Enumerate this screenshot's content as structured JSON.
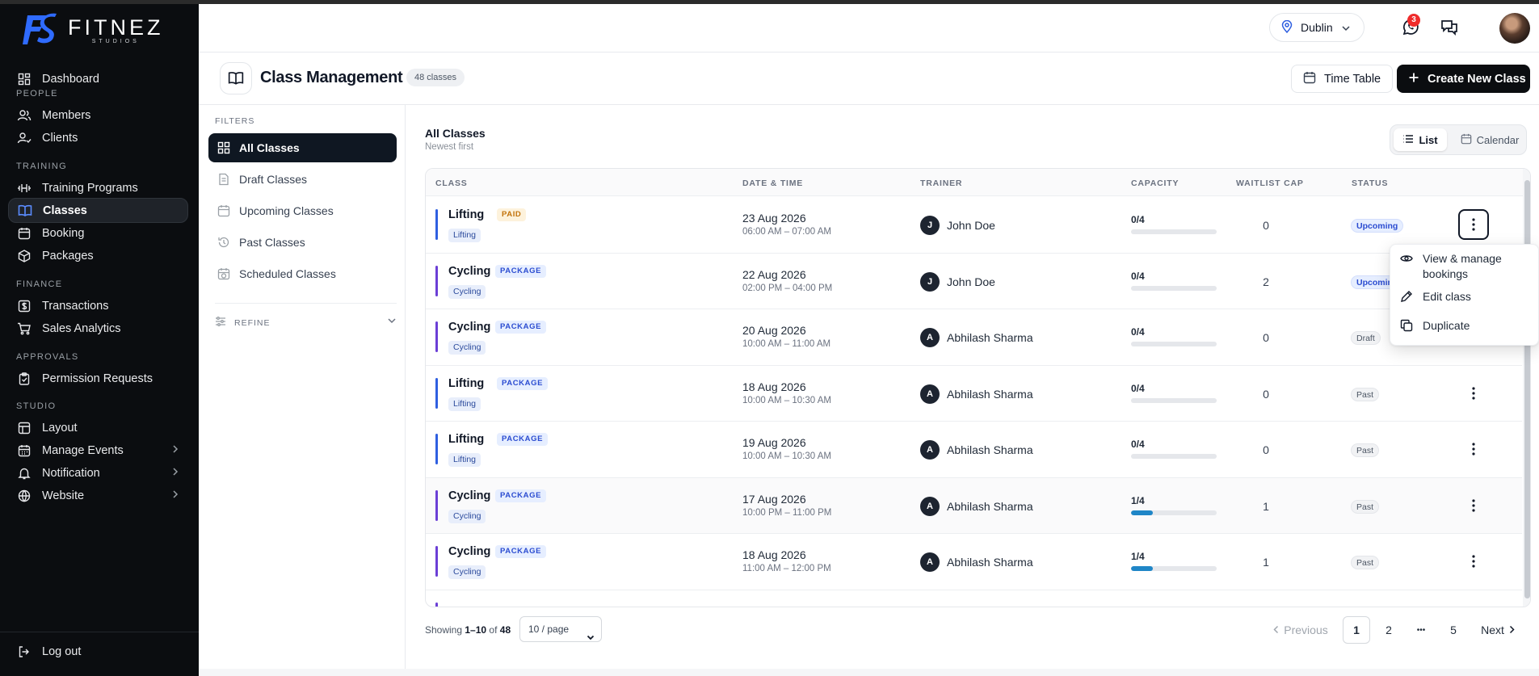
{
  "brand": {
    "title": "FITNEZ",
    "subtitle": "STUDIOS"
  },
  "sidebar": {
    "dashboard": "Dashboard",
    "sections": {
      "people": "PEOPLE",
      "training": "TRAINING",
      "finance": "FINANCE",
      "approvals": "APPROVALS",
      "studio": "STUDIO"
    },
    "items": {
      "members": "Members",
      "clients": "Clients",
      "training_programs": "Training Programs",
      "classes": "Classes",
      "booking": "Booking",
      "packages": "Packages",
      "transactions": "Transactions",
      "sales_analytics": "Sales Analytics",
      "permission_requests": "Permission Requests",
      "layout": "Layout",
      "manage_events": "Manage Events",
      "notification": "Notification",
      "website": "Website"
    },
    "logout": "Log out"
  },
  "header": {
    "location": "Dublin",
    "notifications_count": "3"
  },
  "page": {
    "title": "Class Management",
    "count": "48 classes",
    "timetable_label": "Time Table",
    "create_label": "Create New Class"
  },
  "filters": {
    "label": "FILTERS",
    "items": [
      "All Classes",
      "Draft Classes",
      "Upcoming Classes",
      "Past Classes",
      "Scheduled Classes"
    ],
    "refine": "REFINE"
  },
  "list": {
    "title": "All Classes",
    "subtitle": "Newest first",
    "view_list": "List",
    "view_calendar": "Calendar"
  },
  "table": {
    "headers": {
      "class": "CLASS",
      "datetime": "DATE & TIME",
      "trainer": "TRAINER",
      "capacity": "CAPACITY",
      "waitlist": "WAITLIST CAP",
      "status": "STATUS"
    },
    "rows": [
      {
        "name": "Lifting",
        "tag": "PAID",
        "chip": "Lifting",
        "date": "23 Aug 2026",
        "time": "06:00 AM – 07:00 AM",
        "trainer_initial": "J",
        "trainer": "John Doe",
        "capacity": "0/4",
        "fill": 0,
        "waitlist": "0",
        "status": "Upcoming"
      },
      {
        "name": "Cycling",
        "tag": "PACKAGE",
        "chip": "Cycling",
        "date": "22 Aug 2026",
        "time": "02:00 PM – 04:00 PM",
        "trainer_initial": "J",
        "trainer": "John Doe",
        "capacity": "0/4",
        "fill": 0,
        "waitlist": "2",
        "status": "Upcoming"
      },
      {
        "name": "Cycling",
        "tag": "PACKAGE",
        "chip": "Cycling",
        "date": "20 Aug 2026",
        "time": "10:00 AM – 11:00 AM",
        "trainer_initial": "A",
        "trainer": "Abhilash Sharma",
        "capacity": "0/4",
        "fill": 0,
        "waitlist": "0",
        "status": "Draft"
      },
      {
        "name": "Lifting",
        "tag": "PACKAGE",
        "chip": "Lifting",
        "date": "18 Aug 2026",
        "time": "10:00 AM – 10:30 AM",
        "trainer_initial": "A",
        "trainer": "Abhilash Sharma",
        "capacity": "0/4",
        "fill": 0,
        "waitlist": "0",
        "status": "Past"
      },
      {
        "name": "Lifting",
        "tag": "PACKAGE",
        "chip": "Lifting",
        "date": "19 Aug 2026",
        "time": "10:00 AM – 10:30 AM",
        "trainer_initial": "A",
        "trainer": "Abhilash Sharma",
        "capacity": "0/4",
        "fill": 0,
        "waitlist": "0",
        "status": "Past"
      },
      {
        "name": "Cycling",
        "tag": "PACKAGE",
        "chip": "Cycling",
        "date": "17 Aug 2026",
        "time": "10:00 PM – 11:00 PM",
        "trainer_initial": "A",
        "trainer": "Abhilash Sharma",
        "capacity": "1/4",
        "fill": 0.25,
        "waitlist": "1",
        "status": "Past"
      },
      {
        "name": "Cycling",
        "tag": "PACKAGE",
        "chip": "Cycling",
        "date": "18 Aug 2026",
        "time": "11:00 AM – 12:00 PM",
        "trainer_initial": "A",
        "trainer": "Abhilash Sharma",
        "capacity": "1/4",
        "fill": 0.25,
        "waitlist": "1",
        "status": "Past"
      }
    ]
  },
  "menu": {
    "view_manage": "View & manage bookings",
    "edit": "Edit class",
    "duplicate": "Duplicate"
  },
  "footer": {
    "showing_prefix": "Showing ",
    "showing_range": "1–10",
    "showing_of": " of ",
    "showing_total": "48",
    "per_page": "10 / page",
    "previous": "Previous",
    "pages": [
      "1",
      "2",
      "•••",
      "5"
    ],
    "next": "Next"
  },
  "colors": {
    "accent_lifting": "#2f5fe0",
    "accent_cycling": "#6b3fd6",
    "sidebar_bg": "#0b0d10",
    "primary_button": "#0b0d10",
    "capacity_fill": "#1f86c7"
  }
}
